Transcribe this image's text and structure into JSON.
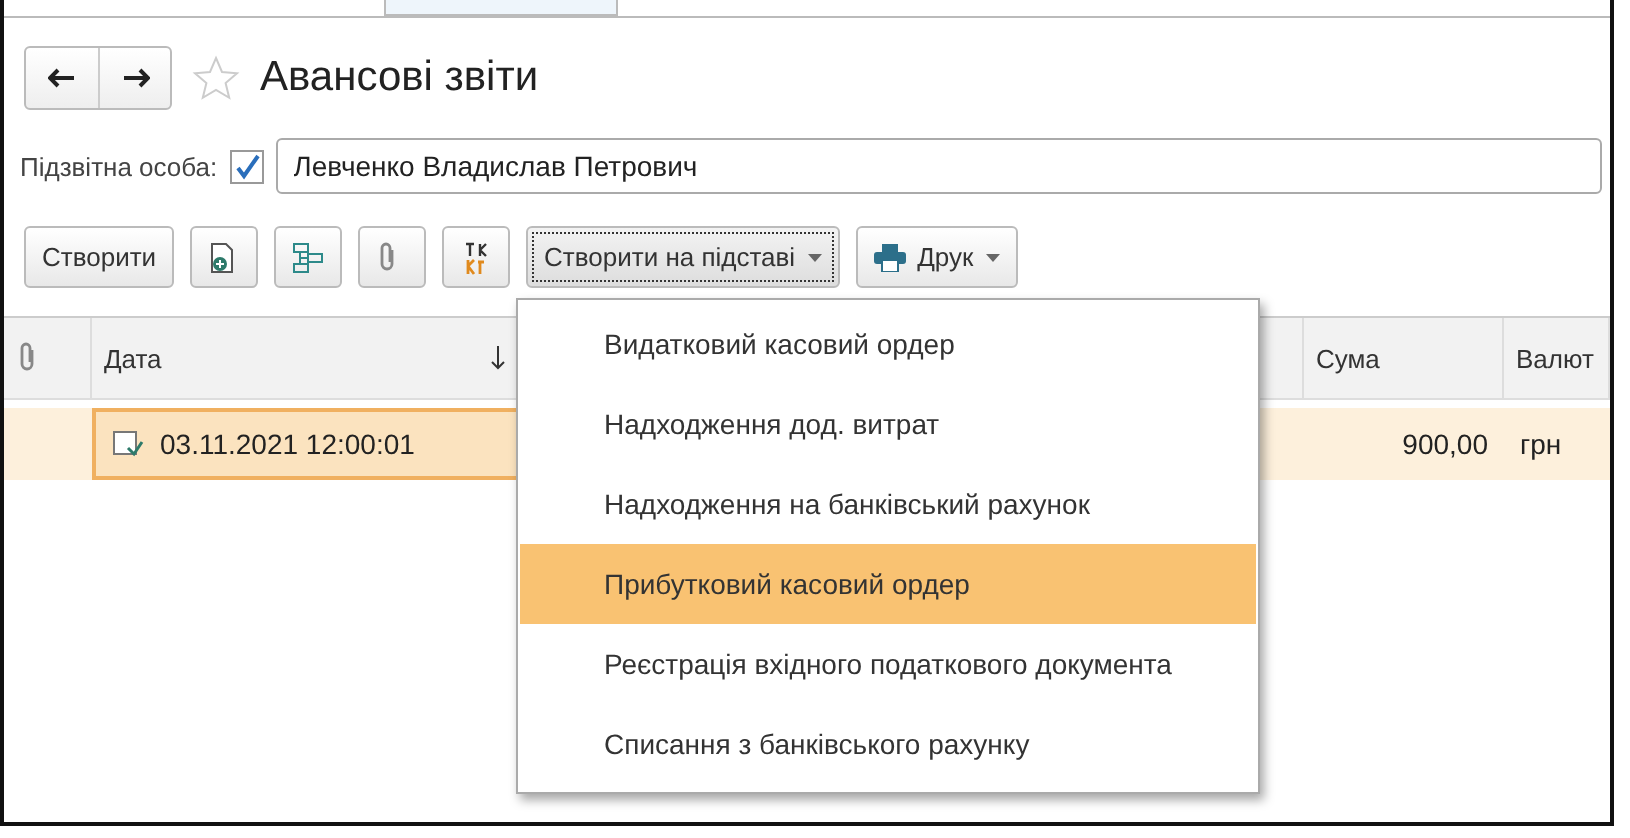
{
  "window": {
    "title": "Авансові звіти",
    "favorite": false
  },
  "filter": {
    "label": "Підзвітна особа:",
    "checked": true,
    "value": "Левченко Владислав Петрович"
  },
  "toolbar": {
    "create": "Створити",
    "create_based": "Створити на підставі",
    "print": "Друк"
  },
  "menu": [
    {
      "label": "Видатковий касовий ордер",
      "selected": false
    },
    {
      "label": "Надходження дод. витрат",
      "selected": false
    },
    {
      "label": "Надходження на банківський рахунок",
      "selected": false
    },
    {
      "label": "Прибутковий касовий ордер",
      "selected": true
    },
    {
      "label": "Реєстрація вхідного податкового документа",
      "selected": false
    },
    {
      "label": "Списання з банківського рахунку",
      "selected": false
    }
  ],
  "table": {
    "columns": [
      "Дата",
      "Сума",
      "Валют"
    ],
    "rows": [
      {
        "date": "03.11.2021 12:00:01",
        "sum": "900,00",
        "currency": "грн",
        "selected": true
      }
    ]
  }
}
